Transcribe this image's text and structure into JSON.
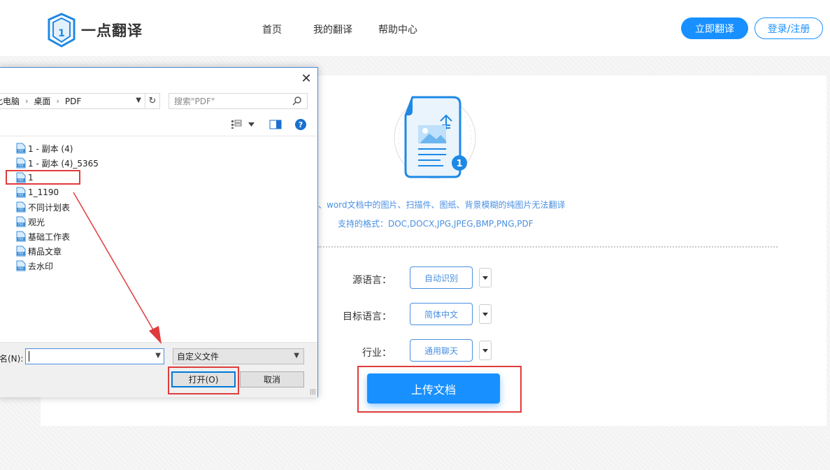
{
  "header": {
    "logo_text": "一点翻译",
    "logo_icon_text": "1",
    "nav": [
      "首页",
      "我的翻译",
      "帮助中心"
    ],
    "translate_button": "立即翻译",
    "login_button": "登录/注册"
  },
  "upload": {
    "hint_line1": "、word文档中的图片、扫描件、图纸、背景模糊的纯图片无法翻译",
    "hint_line2": "支持的格式：DOC,DOCX,JPG,JPEG,BMP,PNG,PDF",
    "badge": "1",
    "form": [
      {
        "label": "源语言：",
        "value": "自动识别"
      },
      {
        "label": "目标语言：",
        "value": "简体中文"
      },
      {
        "label": "行业：",
        "value": "通用聊天"
      }
    ],
    "upload_button": "上传文档"
  },
  "dialog": {
    "address": [
      "此电脑",
      "桌面",
      "PDF"
    ],
    "search_placeholder": "搜索\"PDF\"",
    "files": [
      "1 - 副本 (4)",
      "1 - 副本 (4)_5365",
      "1",
      "1_1190",
      "不同计划表",
      "观光",
      "基础工作表",
      "精品文章",
      "去水印"
    ],
    "file_icon_text": "PDF",
    "filename_label": "名(N):",
    "filename_value": "",
    "filetype": "自定义文件",
    "open_button": "打开(O)",
    "cancel_button": "取消",
    "help_glyph": "?",
    "close_glyph": "✕"
  },
  "colors": {
    "accent": "#1890ff",
    "highlight_box": "#e03c3c",
    "hint_text": "#4a90e2"
  }
}
